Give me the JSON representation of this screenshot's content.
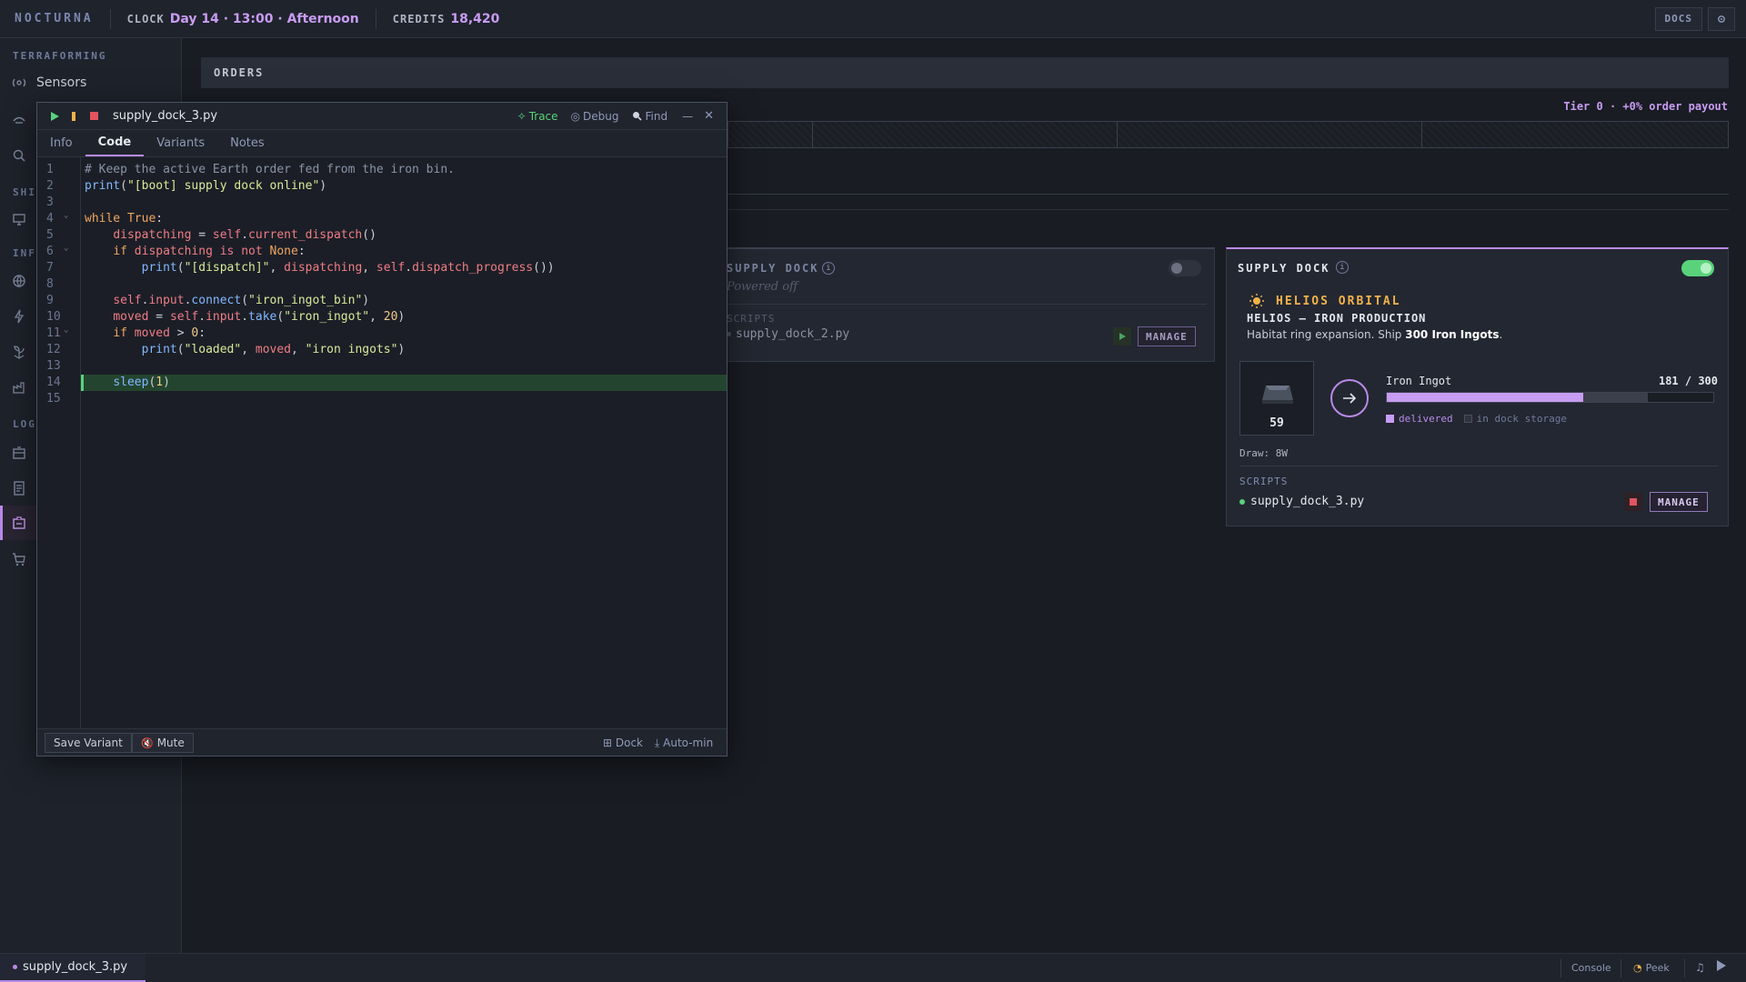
{
  "app": {
    "name": "NOCTURNA",
    "clock_label": "CLOCK",
    "clock_value": "Day 14 · 13:00 · Afternoon",
    "credits_label": "CREDITS",
    "credits_value": "18,420",
    "docs_label": "DOCS"
  },
  "sidebar": {
    "section_terraforming": "TERRAFORMING",
    "sensors_label": "Sensors",
    "section_shi": "SHI",
    "section_inf": "INF",
    "section_log": "LOG"
  },
  "orders": {
    "header": "ORDERS",
    "tier_text": "Tier 0 · +0% order payout"
  },
  "dock2": {
    "title": "SUPPLY DOCK",
    "status": "Powered off",
    "scripts_label": "SCRIPTS",
    "script_name": "supply_dock_2.py",
    "manage_label": "MANAGE",
    "powered": false
  },
  "dock3": {
    "title": "SUPPLY DOCK",
    "client": "HELIOS ORBITAL",
    "order_title": "HELIOS — IRON PRODUCTION",
    "order_desc_prefix": "Habitat ring expansion. Ship ",
    "order_desc_bold": "300 Iron Ingots",
    "order_desc_suffix": ".",
    "item_count": "59",
    "item_name": "Iron Ingot",
    "progress_text": "181 / 300",
    "delivered_fraction": 0.603,
    "storage_fraction": 0.197,
    "legend_delivered": "delivered",
    "legend_storage": "in dock storage",
    "draw": "Draw: 8W",
    "scripts_label": "SCRIPTS",
    "script_name": "supply_dock_3.py",
    "manage_label": "MANAGE",
    "powered": true
  },
  "editor": {
    "filename": "supply_dock_3.py",
    "trace_label": "Trace",
    "debug_label": "Debug",
    "find_label": "Find",
    "tabs": [
      "Info",
      "Code",
      "Variants",
      "Notes"
    ],
    "active_tab": "Code",
    "line_numbers": [
      "1",
      "2",
      "3",
      "4",
      "5",
      "6",
      "7",
      "8",
      "9",
      "10",
      "11",
      "12",
      "13",
      "14",
      "15"
    ],
    "save_variant_label": "Save Variant",
    "mute_label": "Mute",
    "dock_label": "Dock",
    "automin_label": "Auto-min",
    "code_lines": [
      [
        [
          "c-comment",
          "# Keep the active Earth order fed from the iron bin."
        ]
      ],
      [
        [
          "c-fn",
          "print"
        ],
        [
          "c-plain",
          "("
        ],
        [
          "c-str",
          "\"[boot] supply dock online\""
        ],
        [
          "c-plain",
          ")"
        ]
      ],
      [],
      [
        [
          "c-kw",
          "while"
        ],
        [
          "c-plain",
          " "
        ],
        [
          "c-bool",
          "True"
        ],
        [
          "c-plain",
          ":"
        ]
      ],
      [
        [
          "c-plain",
          "    "
        ],
        [
          "c-var",
          "dispatching"
        ],
        [
          "c-plain",
          " = "
        ],
        [
          "c-self",
          "self"
        ],
        [
          "c-plain",
          "."
        ],
        [
          "c-var",
          "current_dispatch"
        ],
        [
          "c-plain",
          "()"
        ]
      ],
      [
        [
          "c-plain",
          "    "
        ],
        [
          "c-kw",
          "if"
        ],
        [
          "c-plain",
          " "
        ],
        [
          "c-var",
          "dispatching"
        ],
        [
          "c-plain",
          " "
        ],
        [
          "c-kw2",
          "is not"
        ],
        [
          "c-plain",
          " "
        ],
        [
          "c-bool",
          "None"
        ],
        [
          "c-plain",
          ":"
        ]
      ],
      [
        [
          "c-plain",
          "        "
        ],
        [
          "c-fn",
          "print"
        ],
        [
          "c-plain",
          "("
        ],
        [
          "c-str",
          "\"[dispatch]\""
        ],
        [
          "c-plain",
          ", "
        ],
        [
          "c-var",
          "dispatching"
        ],
        [
          "c-plain",
          ", "
        ],
        [
          "c-self",
          "self"
        ],
        [
          "c-plain",
          "."
        ],
        [
          "c-var",
          "dispatch_progress"
        ],
        [
          "c-plain",
          "())"
        ]
      ],
      [],
      [
        [
          "c-plain",
          "    "
        ],
        [
          "c-self",
          "self"
        ],
        [
          "c-plain",
          "."
        ],
        [
          "c-var",
          "input"
        ],
        [
          "c-plain",
          "."
        ],
        [
          "c-fn",
          "connect"
        ],
        [
          "c-plain",
          "("
        ],
        [
          "c-str",
          "\"iron_ingot_bin\""
        ],
        [
          "c-plain",
          ")"
        ]
      ],
      [
        [
          "c-plain",
          "    "
        ],
        [
          "c-var",
          "moved"
        ],
        [
          "c-plain",
          " = "
        ],
        [
          "c-self",
          "self"
        ],
        [
          "c-plain",
          "."
        ],
        [
          "c-var",
          "input"
        ],
        [
          "c-plain",
          "."
        ],
        [
          "c-fn",
          "take"
        ],
        [
          "c-plain",
          "("
        ],
        [
          "c-str",
          "\"iron_ingot\""
        ],
        [
          "c-plain",
          ", "
        ],
        [
          "c-num",
          "20"
        ],
        [
          "c-plain",
          ")"
        ]
      ],
      [
        [
          "c-plain",
          "    "
        ],
        [
          "c-kw",
          "if"
        ],
        [
          "c-plain",
          " "
        ],
        [
          "c-var",
          "moved"
        ],
        [
          "c-plain",
          " > "
        ],
        [
          "c-num",
          "0"
        ],
        [
          "c-plain",
          ":"
        ]
      ],
      [
        [
          "c-plain",
          "        "
        ],
        [
          "c-fn",
          "print"
        ],
        [
          "c-plain",
          "("
        ],
        [
          "c-str",
          "\"loaded\""
        ],
        [
          "c-plain",
          ", "
        ],
        [
          "c-var",
          "moved"
        ],
        [
          "c-plain",
          ", "
        ],
        [
          "c-str",
          "\"iron ingots\""
        ],
        [
          "c-plain",
          ")"
        ]
      ],
      [],
      [
        [
          "c-plain",
          "    "
        ],
        [
          "c-fn",
          "sleep"
        ],
        [
          "c-plain",
          "("
        ],
        [
          "c-num",
          "1"
        ],
        [
          "c-plain",
          ")"
        ]
      ],
      []
    ],
    "highlighted_line": 14
  },
  "statusbar": {
    "tab_label": "supply_dock_3.py",
    "console_label": "Console",
    "peek_label": "Peek"
  },
  "colors": {
    "accent": "#b98ae8",
    "credits": "#c89cf2",
    "ok_green": "#59d37b",
    "danger_red": "#e2545e",
    "client_gold": "#f2b24a"
  }
}
